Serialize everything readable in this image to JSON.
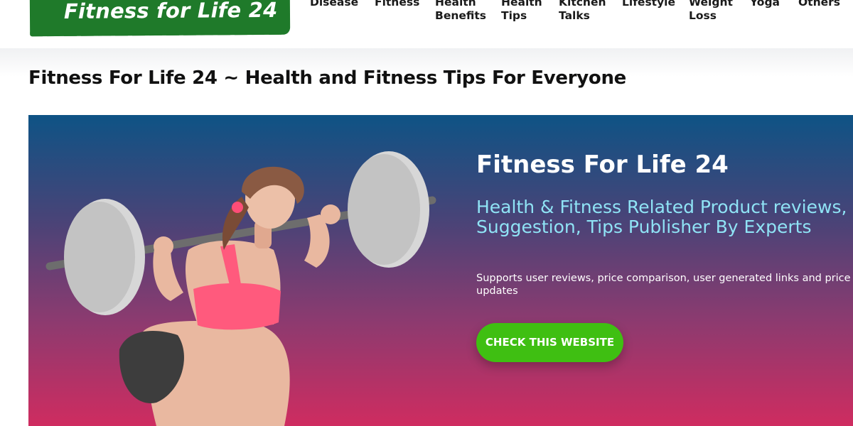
{
  "site": {
    "logo_text": "Fitness for Life 24"
  },
  "nav": {
    "items": [
      {
        "lines": [
          "Disease"
        ]
      },
      {
        "lines": [
          "Fitness"
        ]
      },
      {
        "lines": [
          "Health",
          "Benefits"
        ]
      },
      {
        "lines": [
          "Health",
          "Tips"
        ]
      },
      {
        "lines": [
          "Kitchen",
          "Talks"
        ]
      },
      {
        "lines": [
          "Lifestyle"
        ]
      },
      {
        "lines": [
          "Weight",
          "Loss"
        ]
      },
      {
        "lines": [
          "Yoga"
        ]
      },
      {
        "lines": [
          "Others"
        ]
      }
    ]
  },
  "page": {
    "title": "Fitness For Life 24 ~ Health and Fitness Tips For Everyone"
  },
  "hero": {
    "title": "Fitness For Life 24",
    "subtitle": "Health & Fitness Related Product reviews, Suggestion, Tips Publisher By Experts",
    "description": "Supports user reviews, price comparison, user generated links and price updates",
    "cta_label": "CHECK THIS WEBSITE",
    "illustration_icon": "woman-barbell-squat-illustration"
  },
  "colors": {
    "logo_bg": "#1f7a2a",
    "hero_top": "#0e5385",
    "hero_bottom": "#cf2c60",
    "subtitle": "#8fe3f5",
    "cta": "#3fbf12"
  }
}
